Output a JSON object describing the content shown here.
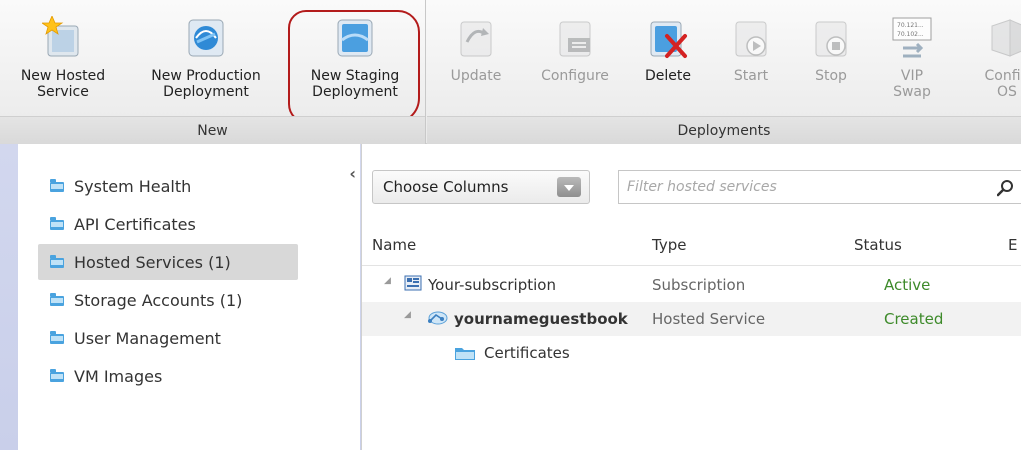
{
  "ribbon": {
    "groups": {
      "new": "New",
      "deployments": "Deployments"
    },
    "buttons": {
      "new_hosted_service": "New Hosted\nService",
      "new_production_deployment": "New Production\nDeployment",
      "new_staging_deployment": "New Staging\nDeployment",
      "update": "Update",
      "configure": "Configure",
      "delete": "Delete",
      "start": "Start",
      "stop": "Stop",
      "vip_swap": "VIP\nSwap",
      "configure_os": "Config\nOS"
    },
    "vip_swap_icon_text": [
      "70.121...",
      "70.102..."
    ]
  },
  "sidebar": {
    "collapse": "‹",
    "items": [
      {
        "label": "System Health"
      },
      {
        "label": "API Certificates"
      },
      {
        "label": "Hosted Services (1)"
      },
      {
        "label": "Storage Accounts (1)"
      },
      {
        "label": "User Management"
      },
      {
        "label": "VM Images"
      }
    ],
    "active_index": 2
  },
  "toolbar": {
    "choose_columns": "Choose Columns",
    "filter_placeholder": "Filter hosted services"
  },
  "table": {
    "columns": [
      "Name",
      "Type",
      "Status",
      "E"
    ],
    "rows": [
      {
        "name": "Your-subscription",
        "type": "Subscription",
        "status": "Active"
      },
      {
        "name": "yournameguestbook",
        "type": "Hosted Service",
        "status": "Created"
      },
      {
        "name": "Certificates",
        "type": "",
        "status": ""
      }
    ]
  },
  "colors": {
    "status_green": "#3d8a2a",
    "folder_blue": "#4aa3df",
    "highlight_ring": "#b31b1b"
  }
}
